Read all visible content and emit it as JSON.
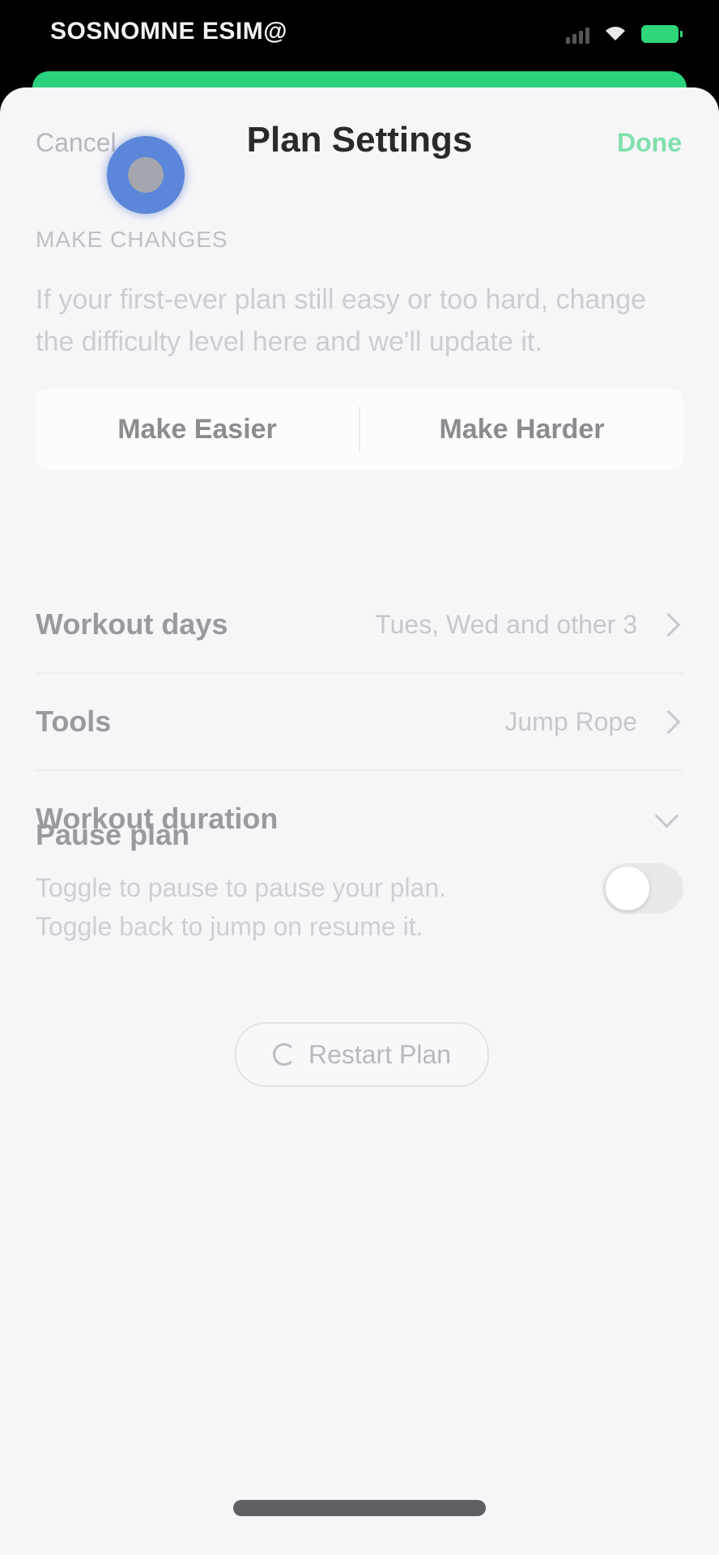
{
  "status_bar": {
    "carrier": "SOSNOMNE ESIM@"
  },
  "nav": {
    "cancel_label": "Cancel",
    "title": "Plan Settings",
    "save_label": "Done"
  },
  "difficulty": {
    "section_label": "MAKE CHANGES",
    "description": "If your first-ever plan still easy or too hard, change the difficulty level here and we'll update it.",
    "easier_label": "Make Easier",
    "harder_label": "Make Harder"
  },
  "settings": {
    "workout_days_label": "Workout days",
    "workout_days_value": "Tues, Wed and other 3",
    "tools_label": "Tools",
    "tools_value": "Jump Rope",
    "workout_duration_label": "Workout duration"
  },
  "pause": {
    "title": "Pause plan",
    "description": "Toggle to pause to pause your plan. Toggle back to jump on resume it.",
    "toggle_on": false
  },
  "restart": {
    "label": "Restart Plan"
  },
  "colors": {
    "accent": "#2bd27c",
    "touch_indicator": "#5b86d9"
  }
}
